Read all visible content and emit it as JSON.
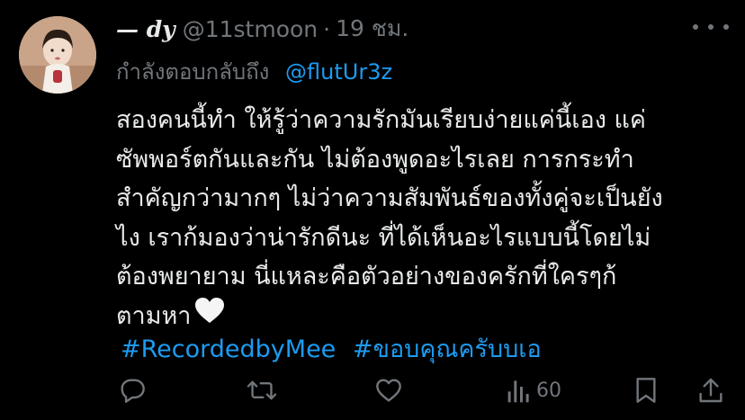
{
  "tweet": {
    "display_name": "— dy",
    "handle": "@11stmoon",
    "separator": "·",
    "time": "19 ชม.",
    "reply_prefix": "กำลังตอบกลับถึง",
    "reply_to": "@flutUr3z",
    "body_lines": [
      "สองคนนี้ทำ ให้รู้ว่าความรักมันเรียบง่ายแค่นี้เอง แค่",
      "ซัพพอร์ตกันและกัน ไม่ต้องพูดอะไรเลย การกระทำ",
      "สำคัญกว่ามากๆ ไม่ว่าความสัมพันธ์ของทั้งคู่จะเป็นยัง",
      "ไง เราก้มองว่าน่ารักดีนะ ที่ได้เห็นอะไรแบบนี้โดยไม่",
      "ต้องพยายาม นี่แหละคือตัวอย่างของครักที่ใครๆก้",
      "ตามหา"
    ],
    "hashtags": [
      "#RecordedbyMee",
      "#ขอบคุณครับบเอ"
    ],
    "views_count": "60"
  },
  "icons": {
    "reply": "reply-icon",
    "retweet": "retweet-icon",
    "like": "heart-outline-icon",
    "views": "views-bar-chart-icon",
    "bookmark": "bookmark-icon",
    "share": "share-icon",
    "more": "more-dots-icon",
    "emoji": "white-heart-emoji-icon"
  },
  "colors": {
    "background": "#000000",
    "text": "#e7e9ea",
    "muted": "#71767b",
    "link": "#1d9bf0"
  }
}
